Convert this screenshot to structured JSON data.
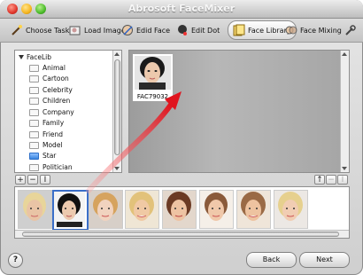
{
  "window": {
    "title": "Abrosoft FaceMixer"
  },
  "toolbar": {
    "choose_task": "Choose Task",
    "load_image": "Load Image",
    "edit_face": "Edid Face",
    "edit_dot": "Edit Dot",
    "face_library": "Face Library",
    "face_mixing": "Face Mixing"
  },
  "tree": {
    "root": "FaceLib",
    "items": [
      "Animal",
      "Cartoon",
      "Celebrity",
      "Children",
      "Company",
      "Family",
      "Friend",
      "Model",
      "Star",
      "Politician"
    ],
    "selected": "Star"
  },
  "library": {
    "faces": [
      {
        "label": "FAC79032"
      }
    ]
  },
  "buttons": {
    "add": "+",
    "remove": "−",
    "rename": "I",
    "up": "↑",
    "back": "Back",
    "next": "Next",
    "help": "?"
  },
  "strip": {
    "count": 8,
    "selected_index": 1
  }
}
